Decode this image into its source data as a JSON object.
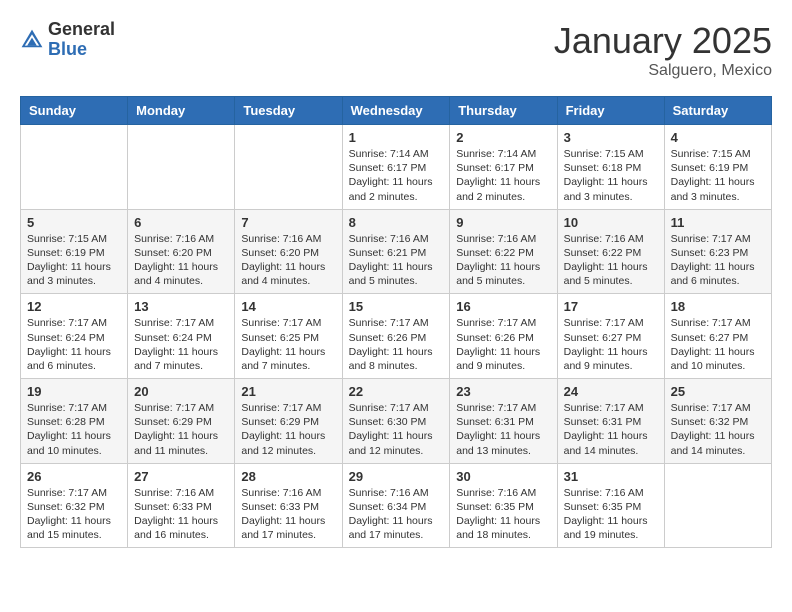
{
  "header": {
    "logo_general": "General",
    "logo_blue": "Blue",
    "month_title": "January 2025",
    "location": "Salguero, Mexico"
  },
  "weekdays": [
    "Sunday",
    "Monday",
    "Tuesday",
    "Wednesday",
    "Thursday",
    "Friday",
    "Saturday"
  ],
  "weeks": [
    [
      {
        "day": "",
        "info": ""
      },
      {
        "day": "",
        "info": ""
      },
      {
        "day": "",
        "info": ""
      },
      {
        "day": "1",
        "info": "Sunrise: 7:14 AM\nSunset: 6:17 PM\nDaylight: 11 hours and 2 minutes."
      },
      {
        "day": "2",
        "info": "Sunrise: 7:14 AM\nSunset: 6:17 PM\nDaylight: 11 hours and 2 minutes."
      },
      {
        "day": "3",
        "info": "Sunrise: 7:15 AM\nSunset: 6:18 PM\nDaylight: 11 hours and 3 minutes."
      },
      {
        "day": "4",
        "info": "Sunrise: 7:15 AM\nSunset: 6:19 PM\nDaylight: 11 hours and 3 minutes."
      }
    ],
    [
      {
        "day": "5",
        "info": "Sunrise: 7:15 AM\nSunset: 6:19 PM\nDaylight: 11 hours and 3 minutes."
      },
      {
        "day": "6",
        "info": "Sunrise: 7:16 AM\nSunset: 6:20 PM\nDaylight: 11 hours and 4 minutes."
      },
      {
        "day": "7",
        "info": "Sunrise: 7:16 AM\nSunset: 6:20 PM\nDaylight: 11 hours and 4 minutes."
      },
      {
        "day": "8",
        "info": "Sunrise: 7:16 AM\nSunset: 6:21 PM\nDaylight: 11 hours and 5 minutes."
      },
      {
        "day": "9",
        "info": "Sunrise: 7:16 AM\nSunset: 6:22 PM\nDaylight: 11 hours and 5 minutes."
      },
      {
        "day": "10",
        "info": "Sunrise: 7:16 AM\nSunset: 6:22 PM\nDaylight: 11 hours and 5 minutes."
      },
      {
        "day": "11",
        "info": "Sunrise: 7:17 AM\nSunset: 6:23 PM\nDaylight: 11 hours and 6 minutes."
      }
    ],
    [
      {
        "day": "12",
        "info": "Sunrise: 7:17 AM\nSunset: 6:24 PM\nDaylight: 11 hours and 6 minutes."
      },
      {
        "day": "13",
        "info": "Sunrise: 7:17 AM\nSunset: 6:24 PM\nDaylight: 11 hours and 7 minutes."
      },
      {
        "day": "14",
        "info": "Sunrise: 7:17 AM\nSunset: 6:25 PM\nDaylight: 11 hours and 7 minutes."
      },
      {
        "day": "15",
        "info": "Sunrise: 7:17 AM\nSunset: 6:26 PM\nDaylight: 11 hours and 8 minutes."
      },
      {
        "day": "16",
        "info": "Sunrise: 7:17 AM\nSunset: 6:26 PM\nDaylight: 11 hours and 9 minutes."
      },
      {
        "day": "17",
        "info": "Sunrise: 7:17 AM\nSunset: 6:27 PM\nDaylight: 11 hours and 9 minutes."
      },
      {
        "day": "18",
        "info": "Sunrise: 7:17 AM\nSunset: 6:27 PM\nDaylight: 11 hours and 10 minutes."
      }
    ],
    [
      {
        "day": "19",
        "info": "Sunrise: 7:17 AM\nSunset: 6:28 PM\nDaylight: 11 hours and 10 minutes."
      },
      {
        "day": "20",
        "info": "Sunrise: 7:17 AM\nSunset: 6:29 PM\nDaylight: 11 hours and 11 minutes."
      },
      {
        "day": "21",
        "info": "Sunrise: 7:17 AM\nSunset: 6:29 PM\nDaylight: 11 hours and 12 minutes."
      },
      {
        "day": "22",
        "info": "Sunrise: 7:17 AM\nSunset: 6:30 PM\nDaylight: 11 hours and 12 minutes."
      },
      {
        "day": "23",
        "info": "Sunrise: 7:17 AM\nSunset: 6:31 PM\nDaylight: 11 hours and 13 minutes."
      },
      {
        "day": "24",
        "info": "Sunrise: 7:17 AM\nSunset: 6:31 PM\nDaylight: 11 hours and 14 minutes."
      },
      {
        "day": "25",
        "info": "Sunrise: 7:17 AM\nSunset: 6:32 PM\nDaylight: 11 hours and 14 minutes."
      }
    ],
    [
      {
        "day": "26",
        "info": "Sunrise: 7:17 AM\nSunset: 6:32 PM\nDaylight: 11 hours and 15 minutes."
      },
      {
        "day": "27",
        "info": "Sunrise: 7:16 AM\nSunset: 6:33 PM\nDaylight: 11 hours and 16 minutes."
      },
      {
        "day": "28",
        "info": "Sunrise: 7:16 AM\nSunset: 6:33 PM\nDaylight: 11 hours and 17 minutes."
      },
      {
        "day": "29",
        "info": "Sunrise: 7:16 AM\nSunset: 6:34 PM\nDaylight: 11 hours and 17 minutes."
      },
      {
        "day": "30",
        "info": "Sunrise: 7:16 AM\nSunset: 6:35 PM\nDaylight: 11 hours and 18 minutes."
      },
      {
        "day": "31",
        "info": "Sunrise: 7:16 AM\nSunset: 6:35 PM\nDaylight: 11 hours and 19 minutes."
      },
      {
        "day": "",
        "info": ""
      }
    ]
  ]
}
